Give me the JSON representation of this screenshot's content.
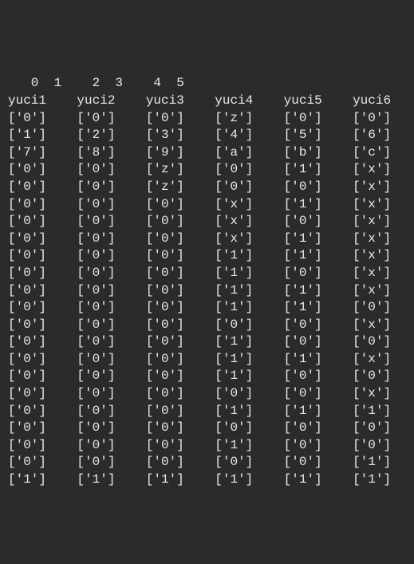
{
  "indices_line": "   0  1    2  3    4  5",
  "headers": [
    "yuci1",
    "yuci2",
    "yuci3",
    "yuci4",
    "yuci5",
    "yuci6"
  ],
  "rows": [
    [
      "0",
      "0",
      "0",
      "z",
      "0",
      "0"
    ],
    [
      "1",
      "2",
      "3",
      "4",
      "5",
      "6"
    ],
    [
      "7",
      "8",
      "9",
      "a",
      "b",
      "c"
    ],
    [
      "0",
      "0",
      "z",
      "0",
      "1",
      "x"
    ],
    [
      "0",
      "0",
      "z",
      "0",
      "0",
      "x"
    ],
    [
      "0",
      "0",
      "0",
      "x",
      "1",
      "x"
    ],
    [
      "0",
      "0",
      "0",
      "x",
      "0",
      "x"
    ],
    [
      "0",
      "0",
      "0",
      "x",
      "1",
      "x"
    ],
    [
      "0",
      "0",
      "0",
      "1",
      "1",
      "x"
    ],
    [
      "0",
      "0",
      "0",
      "1",
      "0",
      "x"
    ],
    [
      "0",
      "0",
      "0",
      "1",
      "1",
      "x"
    ],
    [
      "0",
      "0",
      "0",
      "1",
      "1",
      "0"
    ],
    [
      "0",
      "0",
      "0",
      "0",
      "0",
      "x"
    ],
    [
      "0",
      "0",
      "0",
      "1",
      "0",
      "0"
    ],
    [
      "0",
      "0",
      "0",
      "1",
      "1",
      "x"
    ],
    [
      "0",
      "0",
      "0",
      "1",
      "0",
      "0"
    ],
    [
      "0",
      "0",
      "0",
      "0",
      "0",
      "x"
    ],
    [
      "0",
      "0",
      "0",
      "1",
      "1",
      "1"
    ],
    [
      "0",
      "0",
      "0",
      "0",
      "0",
      "0"
    ],
    [
      "0",
      "0",
      "0",
      "1",
      "0",
      "0"
    ],
    [
      "0",
      "0",
      "0",
      "0",
      "0",
      "1"
    ],
    [
      "1",
      "1",
      "1",
      "1",
      "1",
      "1"
    ]
  ]
}
